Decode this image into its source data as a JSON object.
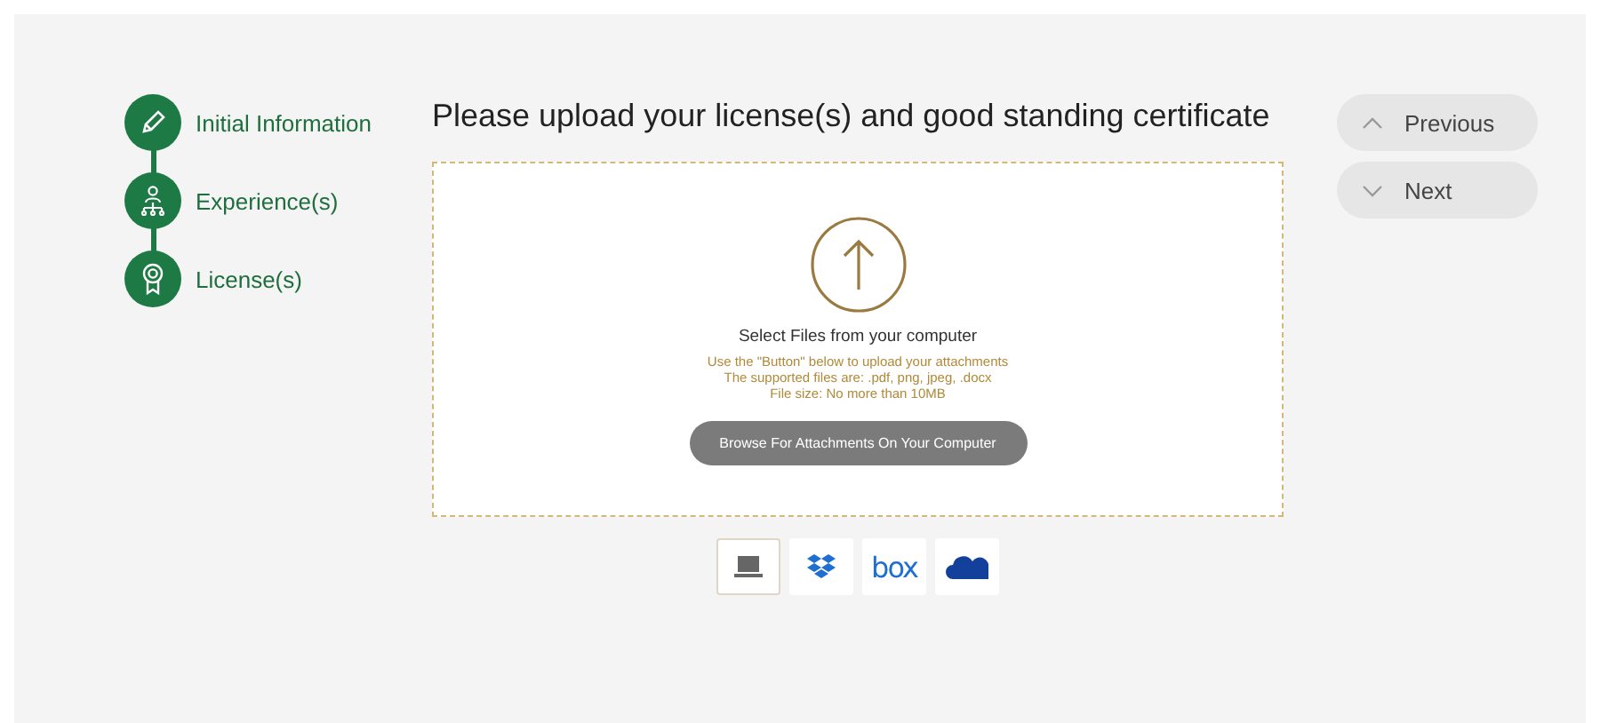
{
  "steps": [
    {
      "kind": "pen",
      "label": "Initial Information"
    },
    {
      "kind": "people",
      "label": "Experience(s)"
    },
    {
      "kind": "award",
      "label": "License(s)"
    }
  ],
  "title": "Please upload your license(s) and good standing certificate",
  "upload": {
    "heading": "Select Files from your computer",
    "hints": [
      "Use the \"Button\" below to upload your attachments",
      "The supported files are: .pdf, png, jpeg, .docx",
      "File size: No more than 10MB"
    ],
    "button": "Browse For Attachments On Your Computer"
  },
  "sources": [
    {
      "kind": "laptop",
      "selected": true
    },
    {
      "kind": "dropbox",
      "selected": false
    },
    {
      "kind": "box",
      "label": "box",
      "selected": false
    },
    {
      "kind": "cloud",
      "selected": false
    }
  ],
  "nav": [
    {
      "kind": "up",
      "label": "Previous"
    },
    {
      "kind": "down",
      "label": "Next"
    }
  ]
}
